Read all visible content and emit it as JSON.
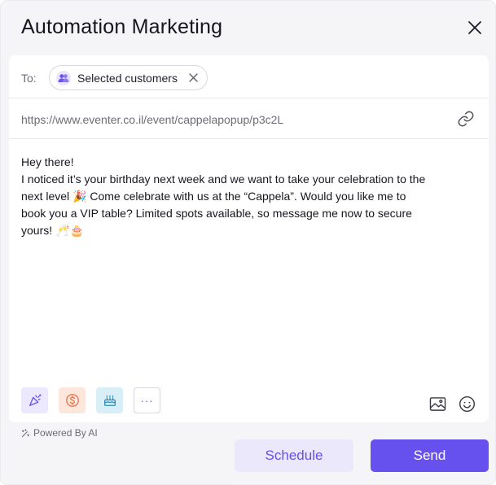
{
  "header": {
    "title": "Automation Marketing"
  },
  "recipient": {
    "label": "To:",
    "chip_label": "Selected customers"
  },
  "link": {
    "url": "https://www.eventer.co.il/event/cappelapopup/p3c2L"
  },
  "message": {
    "line1": "Hey there!",
    "line2": "I noticed it’s your birthday next week and we want to take your celebration to the next level 🎉  Come celebrate with us at the “Cappela”. Would you like me to book you a VIP table? Limited spots available, so message me now to secure yours! 🥂🎂"
  },
  "toolbar": {
    "icons": [
      "party-popper-icon",
      "dollar-coin-icon",
      "birthday-cake-icon",
      "more-icon",
      "image-icon",
      "emoji-icon"
    ],
    "more_label": "···"
  },
  "footer": {
    "powered_by": "Powered By AI",
    "schedule_label": "Schedule",
    "send_label": "Send"
  },
  "colors": {
    "accent": "#6651ee",
    "accent_light": "#ebe8fb",
    "background": "#f5f5f7"
  }
}
